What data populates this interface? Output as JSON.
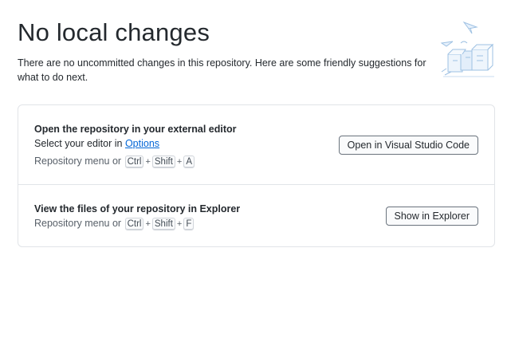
{
  "header": {
    "title": "No local changes",
    "subtitle": "There are no uncommitted changes in this repository. Here are some friendly suggestions for what to do next."
  },
  "illustration": {
    "icon": "paper-airplanes-boxes-illustration"
  },
  "actions": [
    {
      "title": "Open the repository in your external editor",
      "description_prefix": "Select your editor in ",
      "description_link": "Options",
      "shortcut_prefix": "Repository menu or",
      "keys": [
        "Ctrl",
        "Shift",
        "A"
      ],
      "button": "Open in Visual Studio Code"
    },
    {
      "title": "View the files of your repository in Explorer",
      "shortcut_prefix": "Repository menu or",
      "keys": [
        "Ctrl",
        "Shift",
        "F"
      ],
      "button": "Show in Explorer"
    }
  ],
  "colors": {
    "accent": "#0366d6",
    "border": "#e1e4e8",
    "text": "#24292e",
    "muted": "#586069"
  }
}
